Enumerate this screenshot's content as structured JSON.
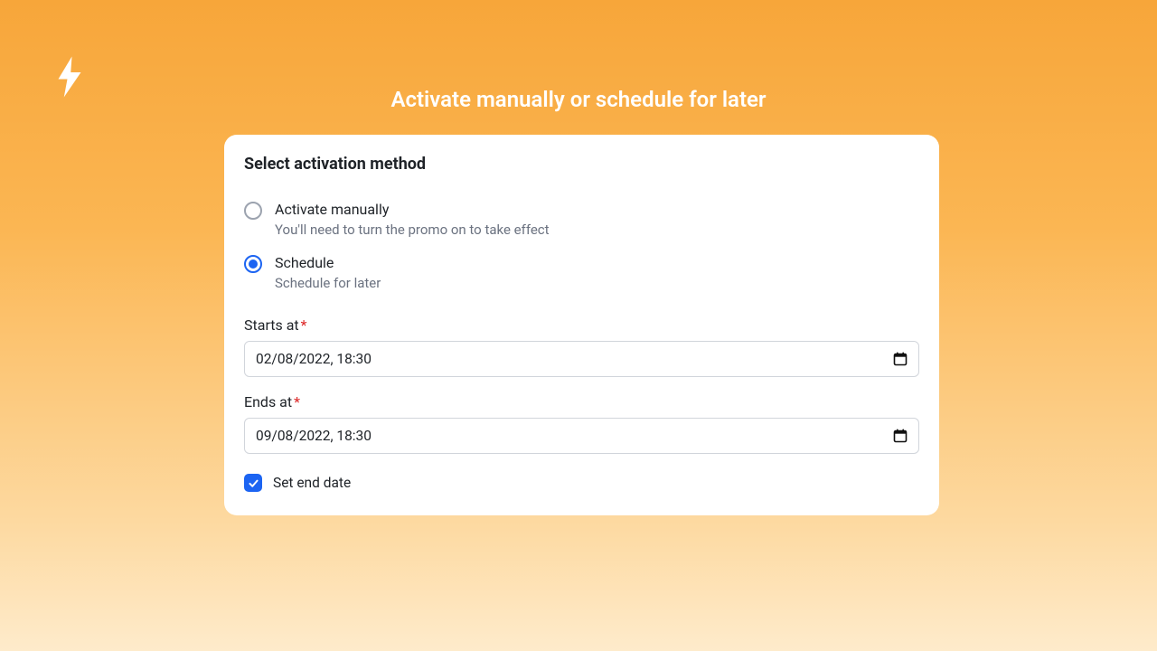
{
  "header": {
    "title": "Activate manually or schedule for later"
  },
  "card": {
    "heading": "Select activation method",
    "options": {
      "manual": {
        "label": "Activate manually",
        "description": "You'll need to turn the promo on to take effect"
      },
      "schedule": {
        "label": "Schedule",
        "description": "Schedule for later"
      }
    },
    "fields": {
      "starts": {
        "label": "Starts at",
        "value": "02/08/2022, 18:30"
      },
      "ends": {
        "label": "Ends at",
        "value": "09/08/2022, 18:30"
      }
    },
    "end_checkbox": {
      "label": "Set end date"
    },
    "required_marker": "*"
  }
}
